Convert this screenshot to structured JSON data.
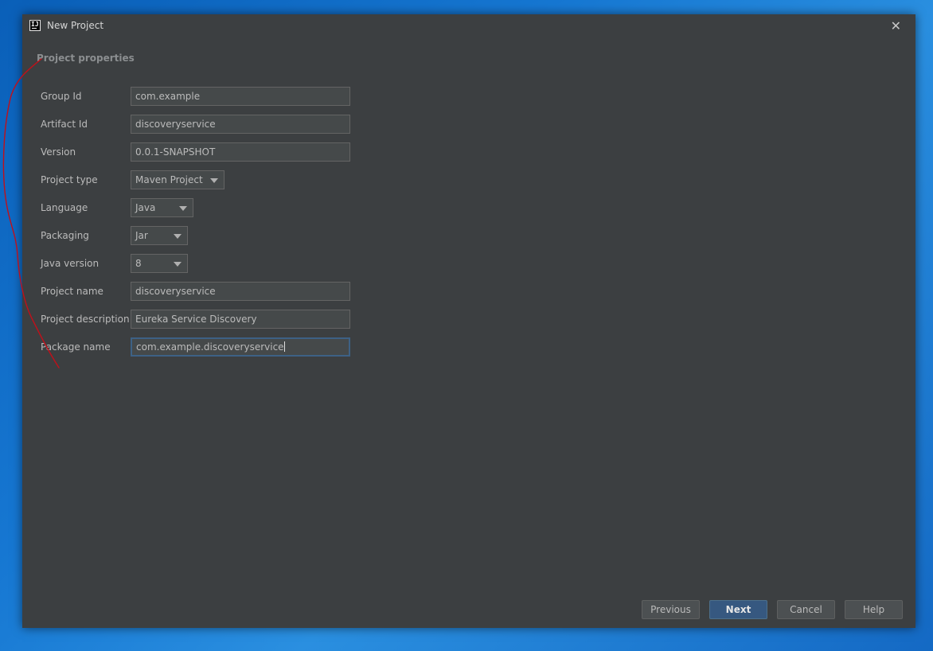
{
  "window": {
    "title": "New Project"
  },
  "section": {
    "title": "Project properties"
  },
  "form": {
    "group_id": {
      "label": "Group Id",
      "value": "com.example"
    },
    "artifact_id": {
      "label": "Artifact Id",
      "value": "discoveryservice"
    },
    "version": {
      "label": "Version",
      "value": "0.0.1-SNAPSHOT"
    },
    "project_type": {
      "label": "Project type",
      "value": "Maven Project"
    },
    "language": {
      "label": "Language",
      "value": "Java"
    },
    "packaging": {
      "label": "Packaging",
      "value": "Jar"
    },
    "java_version": {
      "label": "Java version",
      "value": "8"
    },
    "project_name": {
      "label": "Project name",
      "value": "discoveryservice"
    },
    "project_description": {
      "label": "Project description",
      "value": "Eureka Service Discovery"
    },
    "package_name": {
      "label": "Package name",
      "value": "com.example.discoveryservice"
    }
  },
  "buttons": {
    "previous": "Previous",
    "next": "Next",
    "cancel": "Cancel",
    "help": "Help"
  },
  "icons": {
    "app": "intellij-icon",
    "close": "close-icon",
    "dropdown": "chevron-down-icon"
  },
  "colors": {
    "dialog_bg": "#3c3f41",
    "field_bg": "#45494a",
    "primary_button": "#365880",
    "annotation": "#c0101a"
  }
}
